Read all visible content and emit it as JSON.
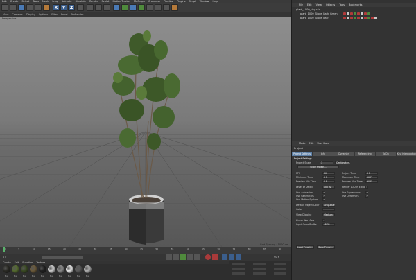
{
  "menu": [
    "Edit",
    "Create",
    "Select",
    "Tools",
    "Mesh",
    "Snap",
    "Animate",
    "Simulate",
    "Render",
    "Sculpt",
    "Motion Tracker",
    "MoGraph",
    "Character",
    "Pipeline",
    "Plugins",
    "Script",
    "Window",
    "Help"
  ],
  "toolbar": {
    "x_label": "X",
    "y_label": "Y",
    "z_label": "Z"
  },
  "viewport": {
    "menu": [
      "View",
      "Cameras",
      "Display",
      "Options",
      "Filter",
      "Panel",
      "ProRender"
    ],
    "label": "Perspective",
    "grid_spacing": "Grid Spacing : 1000 cm"
  },
  "objects": {
    "menu": [
      "File",
      "Edit",
      "View",
      "Objects",
      "Tags",
      "Bookmarks"
    ],
    "items": [
      "plant_1000_tiny.c4d",
      "plant_1000_Stage_Bark_Green",
      "plant_1000_Stage_Leaf"
    ]
  },
  "timeline": {
    "ticks": [
      "0",
      "5",
      "10",
      "15",
      "20",
      "25",
      "30",
      "35",
      "40",
      "45",
      "50",
      "55",
      "60",
      "65",
      "70",
      "75",
      "80",
      "85",
      "90"
    ],
    "frame": "0 F",
    "end": "90 F"
  },
  "materials": {
    "menu": [
      "Create",
      "Edit",
      "Function",
      "Texture"
    ],
    "items": [
      "Mat",
      "Mat",
      "Mat",
      "Mat",
      "Mat",
      "Mat",
      "Mat",
      "Mat",
      "Mat",
      "Mat"
    ],
    "colors": [
      "#2a2a24",
      "#556b2f",
      "#3a4a22",
      "#6b5a3a",
      "#1f1f1f",
      "#cfcfcf",
      "#8a8a8a",
      "#e8e8e8",
      "#5a5a5a",
      "#b0b0b0"
    ]
  },
  "attributes": {
    "menu": [
      "Mode",
      "Edit",
      "User Data"
    ],
    "title": "Project",
    "tabs": [
      "Project Settings",
      "Info",
      "Dynamics",
      "Referencing",
      "To Do",
      "Key Interpolation"
    ],
    "section": "Project Settings",
    "fields_left": [
      {
        "label": "Project Scale",
        "value": "1"
      },
      {
        "label": "FPS",
        "value": "30"
      },
      {
        "label": "Minimum Time",
        "value": "0 F"
      },
      {
        "label": "Preview Min Time",
        "value": "0 F"
      },
      {
        "label": "Level of Detail",
        "value": "100 %"
      },
      {
        "label": "Use Animation",
        "value": "✓"
      },
      {
        "label": "Use Generators",
        "value": "✓"
      },
      {
        "label": "Use Motion System",
        "value": "✓"
      },
      {
        "label": "Default Object Color",
        "value": "Gray-Blue"
      },
      {
        "label": "Color",
        "value": ""
      },
      {
        "label": "View Clipping",
        "value": "Medium"
      },
      {
        "label": "Linear Workflow",
        "value": "✓"
      },
      {
        "label": "Input Color Profile",
        "value": "sRGB"
      }
    ],
    "fields_right": [
      {
        "label": "Project Time",
        "value": "0 F"
      },
      {
        "label": "Maximum Time",
        "value": "90 F"
      },
      {
        "label": "Preview Max Time",
        "value": "90 F"
      },
      {
        "label": "Render LOD in Editor",
        "value": ""
      },
      {
        "label": "Use Expressions",
        "value": "✓"
      },
      {
        "label": "Use Deformers",
        "value": "✓"
      }
    ],
    "units": "Centimeters",
    "scale_button": "Scale Project...",
    "load_button": "Load Preset...",
    "save_button": "Save Preset..."
  }
}
